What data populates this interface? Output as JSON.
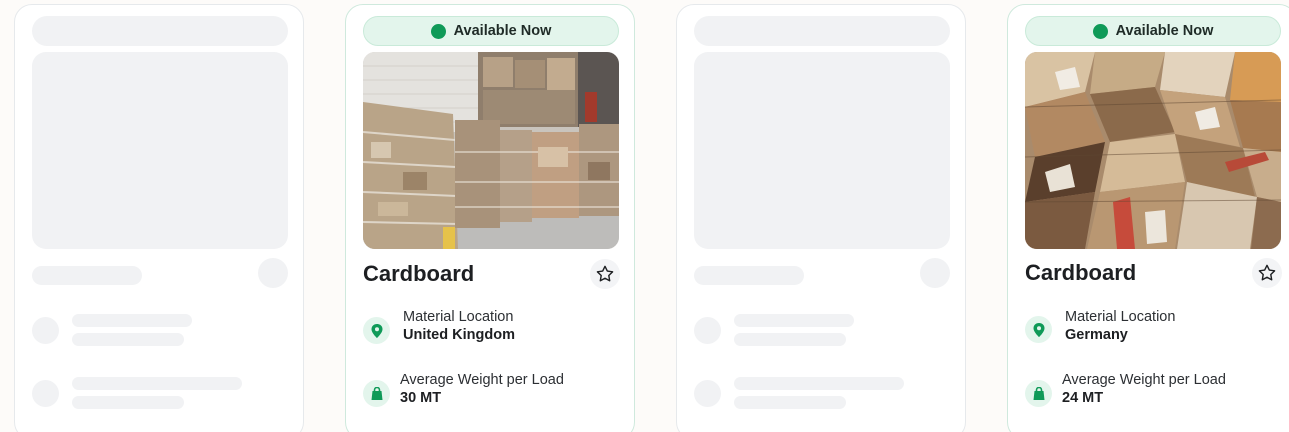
{
  "cards": [
    {
      "state": "loading"
    },
    {
      "state": "loaded",
      "badge": "Available Now",
      "title": "Cardboard",
      "location_label": "Material Location",
      "location_value": "United Kingdom",
      "weight_label": "Average Weight per Load",
      "weight_value": "30 MT"
    },
    {
      "state": "loading"
    },
    {
      "state": "loaded",
      "badge": "Available Now",
      "title": "Cardboard",
      "location_label": "Material Location",
      "location_value": "Germany",
      "weight_label": "Average Weight per Load",
      "weight_value": "24 MT"
    }
  ],
  "icons": {
    "favorite": "star-icon",
    "location": "location-pin-icon",
    "weight": "weight-icon",
    "status": "status-dot-icon"
  },
  "colors": {
    "accent": "#0f9a58",
    "badge_bg": "#e3f5ec",
    "skeleton": "#f1f2f4",
    "text": "#1d1f22"
  }
}
